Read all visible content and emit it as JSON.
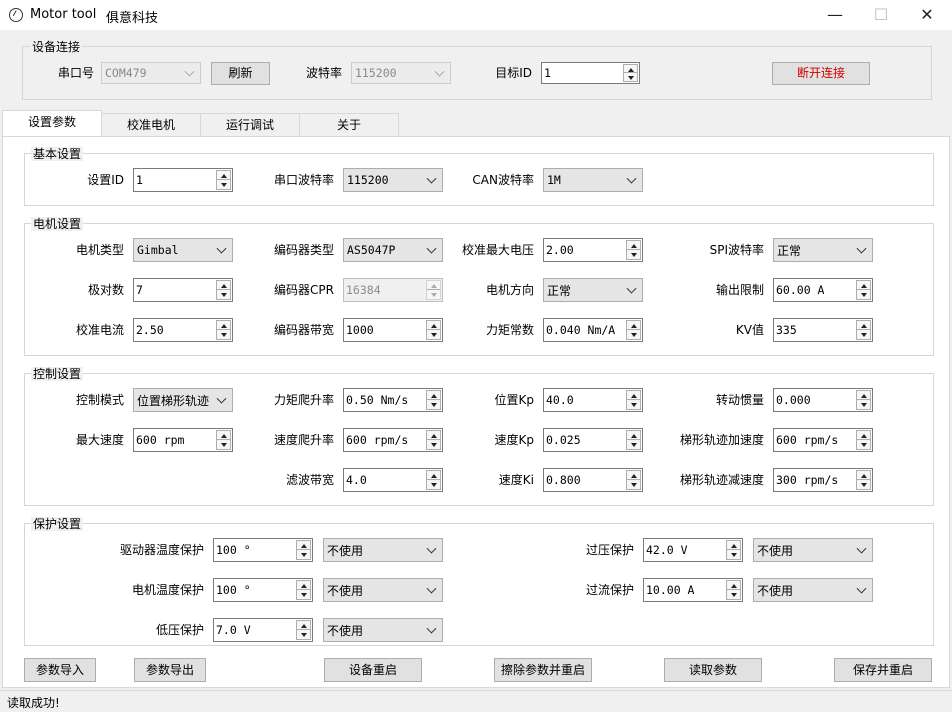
{
  "window": {
    "title": "Motor tool",
    "company": "俱意科技",
    "minimize": "—",
    "maximize": "☐",
    "close": "✕"
  },
  "connection": {
    "group_title": "设备连接",
    "port_label": "串口号",
    "port_value": "COM479",
    "refresh_label": "刷新",
    "baud_label": "波特率",
    "baud_value": "115200",
    "target_label": "目标ID",
    "target_value": "1",
    "disconnect_label": "断开连接",
    "disconnect_color": "#d40000"
  },
  "tabs": [
    {
      "label": "设置参数"
    },
    {
      "label": "校准电机"
    },
    {
      "label": "运行调试"
    },
    {
      "label": "关于"
    }
  ],
  "basic": {
    "title": "基本设置",
    "set_id_label": "设置ID",
    "set_id_value": "1",
    "uart_baud_label": "串口波特率",
    "uart_baud_value": "115200",
    "can_baud_label": "CAN波特率",
    "can_baud_value": "1M"
  },
  "motor": {
    "title": "电机设置",
    "motor_type_label": "电机类型",
    "motor_type_value": "Gimbal",
    "encoder_type_label": "编码器类型",
    "encoder_type_value": "AS5047P",
    "cal_voltage_label": "校准最大电压",
    "cal_voltage_value": "2.00",
    "spi_baud_label": "SPI波特率",
    "spi_baud_value": "正常",
    "pole_pairs_label": "极对数",
    "pole_pairs_value": "7",
    "encoder_cpr_label": "编码器CPR",
    "encoder_cpr_value": "16384",
    "direction_label": "电机方向",
    "direction_value": "正常",
    "output_limit_label": "输出限制",
    "output_limit_value": "60.00 A",
    "cal_current_label": "校准电流",
    "cal_current_value": "2.50",
    "encoder_bw_label": "编码器带宽",
    "encoder_bw_value": "1000",
    "torque_const_label": "力矩常数",
    "torque_const_value": "0.040 Nm/A",
    "kv_label": "KV值",
    "kv_value": "335"
  },
  "control": {
    "title": "控制设置",
    "mode_label": "控制模式",
    "mode_value": "位置梯形轨迹",
    "torque_ramp_label": "力矩爬升率",
    "torque_ramp_value": "0.50 Nm/s",
    "pos_kp_label": "位置Kp",
    "pos_kp_value": "40.0",
    "inertia_label": "转动惯量",
    "inertia_value": "0.000",
    "max_speed_label": "最大速度",
    "max_speed_value": "600 rpm",
    "speed_ramp_label": "速度爬升率",
    "speed_ramp_value": "600 rpm/s",
    "vel_kp_label": "速度Kp",
    "vel_kp_value": "0.025",
    "trap_accel_label": "梯形轨迹加速度",
    "trap_accel_value": "600 rpm/s",
    "filter_bw_label": "滤波带宽",
    "filter_bw_value": "4.0",
    "vel_ki_label": "速度Ki",
    "vel_ki_value": "0.800",
    "trap_decel_label": "梯形轨迹减速度",
    "trap_decel_value": "300 rpm/s"
  },
  "protection": {
    "title": "保护设置",
    "driver_temp_label": "驱动器温度保护",
    "driver_temp_value": "100 °",
    "driver_temp_mode": "不使用",
    "motor_temp_label": "电机温度保护",
    "motor_temp_value": "100 °",
    "motor_temp_mode": "不使用",
    "undervolt_label": "低压保护",
    "undervolt_value": "7.0 V",
    "undervolt_mode": "不使用",
    "overvolt_label": "过压保护",
    "overvolt_value": "42.0 V",
    "overvolt_mode": "不使用",
    "overcurrent_label": "过流保护",
    "overcurrent_value": "10.00 A",
    "overcurrent_mode": "不使用"
  },
  "actions": {
    "import_label": "参数导入",
    "export_label": "参数导出",
    "reboot_label": "设备重启",
    "erase_label": "擦除参数并重启",
    "read_label": "读取参数",
    "save_label": "保存并重启"
  },
  "status": {
    "text": "读取成功!"
  }
}
